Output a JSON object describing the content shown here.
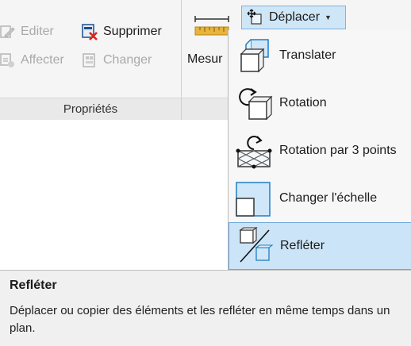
{
  "ribbon": {
    "editer_label": "Editer",
    "supprimer_label": "Supprimer",
    "affecter_label": "Affecter",
    "changer_label": "Changer",
    "proprietes_label": "Propriétés",
    "mesurer_label": "Mesur",
    "deplacer_label": "Déplacer"
  },
  "menu": {
    "items": [
      {
        "label": "Translater",
        "icon": "translate-icon"
      },
      {
        "label": "Rotation",
        "icon": "rotate-icon"
      },
      {
        "label": "Rotation par 3 points",
        "icon": "rotate-3-points-icon"
      },
      {
        "label": "Changer l'échelle",
        "icon": "scale-icon"
      },
      {
        "label": "Refléter",
        "icon": "mirror-icon"
      }
    ]
  },
  "tooltip": {
    "title": "Refléter",
    "description": "Déplacer ou copier des éléments et les refléter en même temps dans un plan."
  },
  "colors": {
    "accent": "#cce4f7",
    "accent_border": "#6ea7d9",
    "delete_red": "#d9261c"
  }
}
